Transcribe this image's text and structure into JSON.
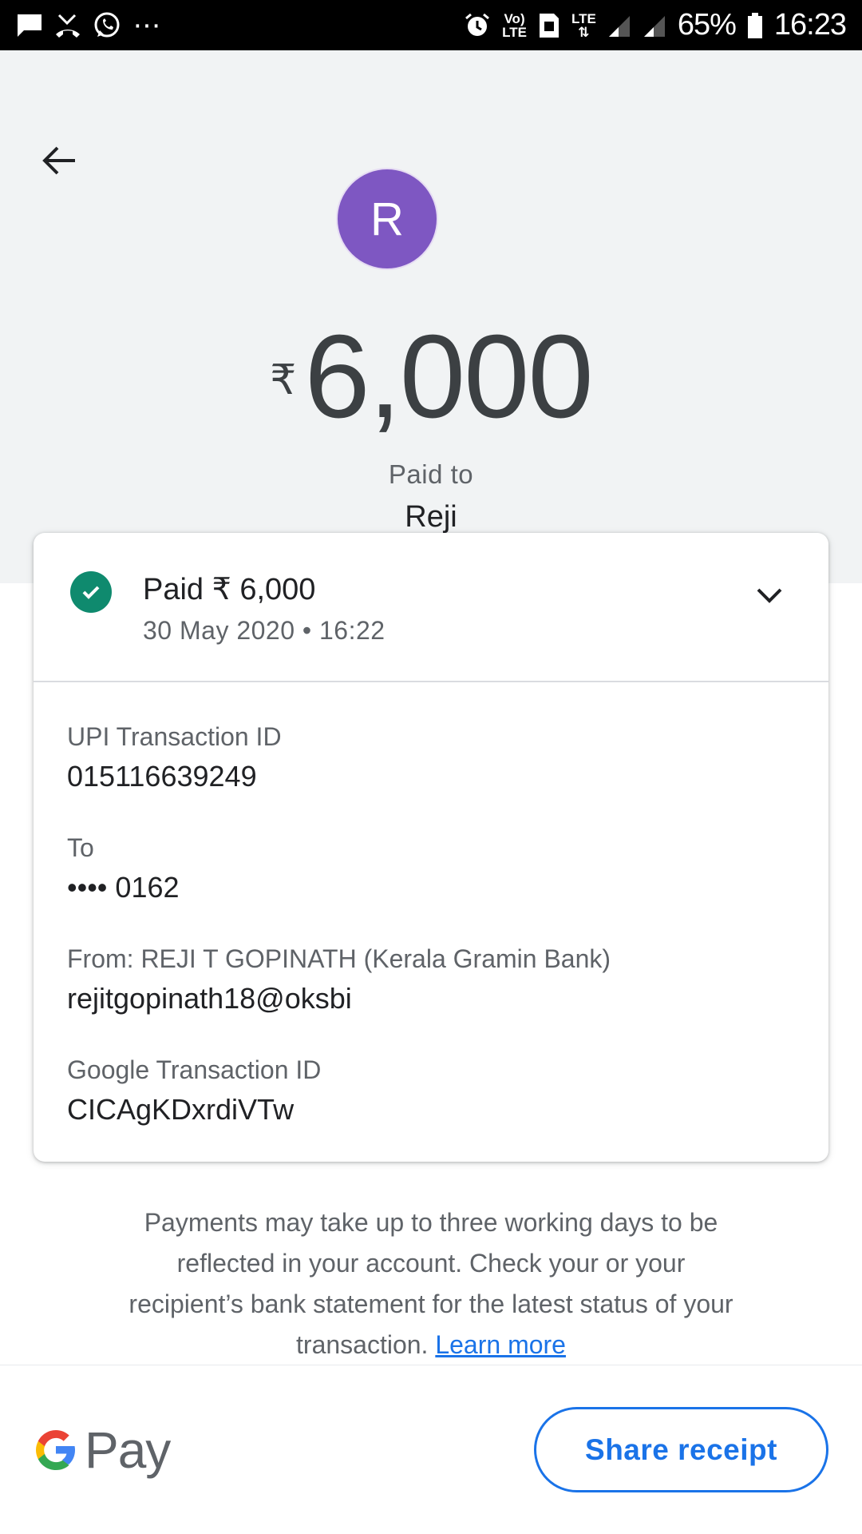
{
  "status_bar": {
    "left_icons": [
      "message-icon",
      "missed-call-icon",
      "whatsapp-icon",
      "more-dots-icon"
    ],
    "more_dots": "···",
    "volte_top": "Vo)",
    "volte_bottom": "LTE",
    "lte_label": "LTE",
    "battery": "65%",
    "time": "16:23"
  },
  "header": {
    "avatar_initial": "R",
    "avatar_color": "#7e57c2",
    "currency_symbol": "₹",
    "amount": "6,000",
    "paid_to_label": "Paid to",
    "payee_name": "Reji"
  },
  "card": {
    "status_line": "Paid ₹ 6,000",
    "status_color": "#0f8a6e",
    "datetime": "30 May 2020 • 16:22",
    "details": [
      {
        "label": "UPI Transaction ID",
        "value": "015116639249"
      },
      {
        "label": "To",
        "value": "•••• 0162"
      },
      {
        "label": "From: REJI T GOPINATH (Kerala Gramin Bank)",
        "value": "rejitgopinath18@oksbi"
      },
      {
        "label": "Google Transaction ID",
        "value": "CICAgKDxrdiVTw"
      }
    ]
  },
  "disclaimer": {
    "text": "Payments may take up to three working days to be reflected in your account. Check your or your recipient’s bank statement for the latest status of your transaction.",
    "link_text": "Learn more"
  },
  "footer": {
    "brand_text": "Pay",
    "share_button": "Share receipt",
    "accent_color": "#1a73e8"
  }
}
